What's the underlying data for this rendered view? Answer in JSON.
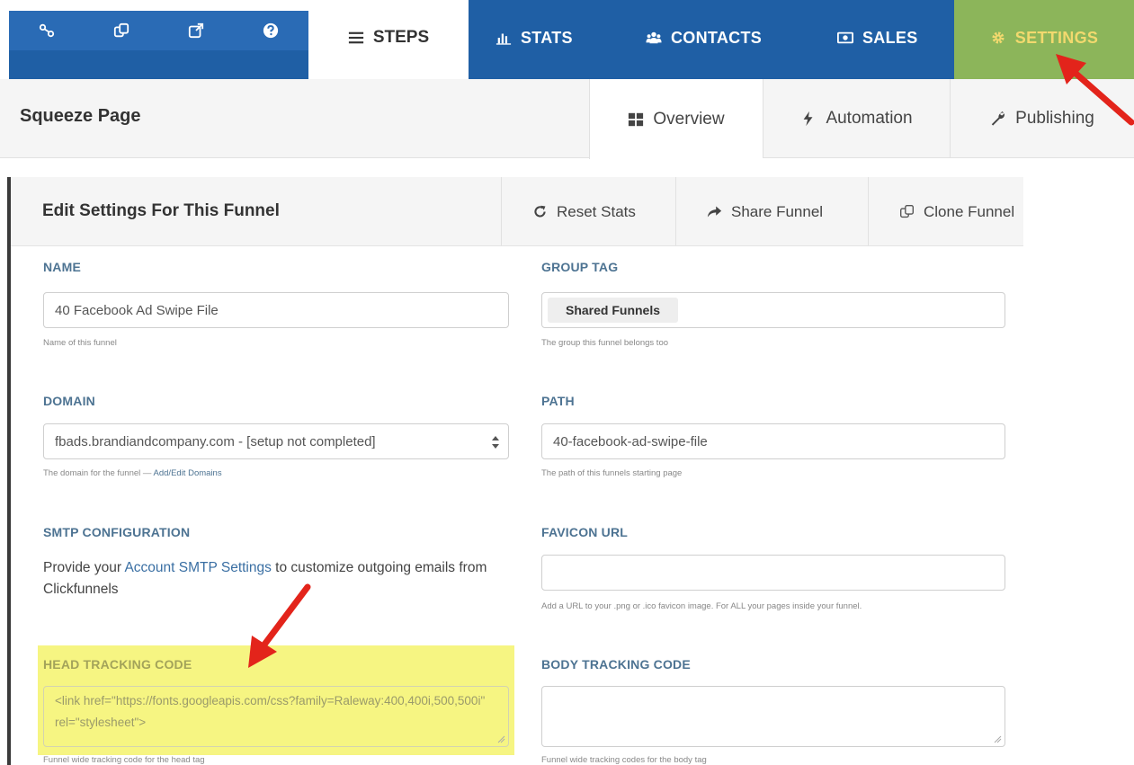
{
  "topnav": {
    "icon_strip": [
      "link-icon",
      "clone-icon",
      "external-link-icon",
      "question-icon"
    ],
    "steps_label": "STEPS",
    "stats_label": "STATS",
    "contacts_label": "CONTACTS",
    "sales_label": "SALES",
    "settings_label": "SETTINGS"
  },
  "subheader": {
    "page_title": "Squeeze Page",
    "tabs": [
      {
        "label": "Overview",
        "icon": "grid-icon"
      },
      {
        "label": "Automation",
        "icon": "bolt-icon"
      },
      {
        "label": "Publishing",
        "icon": "wrench-icon"
      }
    ]
  },
  "panel": {
    "title": "Edit Settings For This Funnel",
    "reset_stats": "Reset Stats",
    "share_funnel": "Share Funnel",
    "clone_funnel": "Clone Funnel"
  },
  "form": {
    "name": {
      "label": "NAME",
      "value": "40 Facebook Ad Swipe File",
      "help": "Name of this funnel"
    },
    "group_tag": {
      "label": "GROUP TAG",
      "value": "Shared Funnels",
      "help": "The group this funnel belongs too"
    },
    "domain": {
      "label": "DOMAIN",
      "value": "fbads.brandiandcompany.com - [setup not completed]",
      "help_prefix": "The domain for the funnel — ",
      "help_link": "Add/Edit Domains"
    },
    "path": {
      "label": "PATH",
      "value": "40-facebook-ad-swipe-file",
      "help": "The path of this funnels starting page"
    },
    "smtp": {
      "label": "SMTP CONFIGURATION",
      "text_prefix": "Provide your ",
      "link": "Account SMTP Settings",
      "text_suffix": " to customize outgoing emails from Clickfunnels"
    },
    "favicon": {
      "label": "FAVICON URL",
      "value": "",
      "help": "Add a URL to your .png or .ico favicon image. For ALL your pages inside your funnel."
    },
    "head_tracking": {
      "label": "HEAD TRACKING CODE",
      "value": "<link href=\"https://fonts.googleapis.com/css?family=Raleway:400,400i,500,500i\" rel=\"stylesheet\">",
      "help": "Funnel wide tracking code for the head tag"
    },
    "body_tracking": {
      "label": "BODY TRACKING CODE",
      "value": "",
      "help": "Funnel wide tracking codes for the body tag"
    }
  },
  "colors": {
    "nav_blue": "#1f5fa5",
    "settings_green": "#8cb55a",
    "settings_text": "#f2d96e",
    "label_blue": "#4d7392",
    "highlight": "#f6f582",
    "arrow_red": "#e3241b"
  }
}
